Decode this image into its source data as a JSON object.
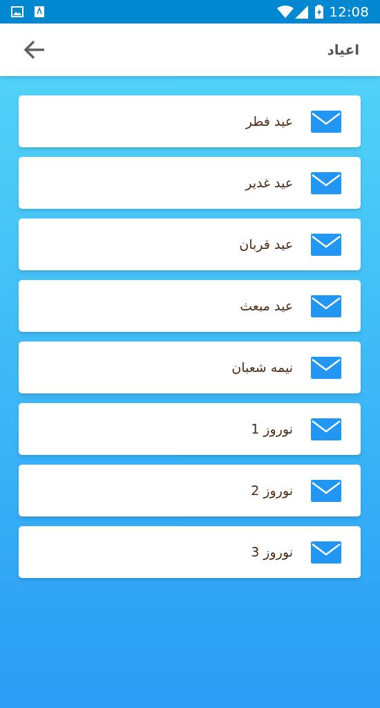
{
  "status_bar": {
    "time": "12:08"
  },
  "header": {
    "title": "اعیاد"
  },
  "items": [
    {
      "label": "عید فطر"
    },
    {
      "label": "عید غدیر"
    },
    {
      "label": "عید قربان"
    },
    {
      "label": "عید مبعث"
    },
    {
      "label": "نیمه شعبان"
    },
    {
      "label": "نوروز 1"
    },
    {
      "label": "نوروز 2"
    },
    {
      "label": "نوروز 3"
    }
  ]
}
